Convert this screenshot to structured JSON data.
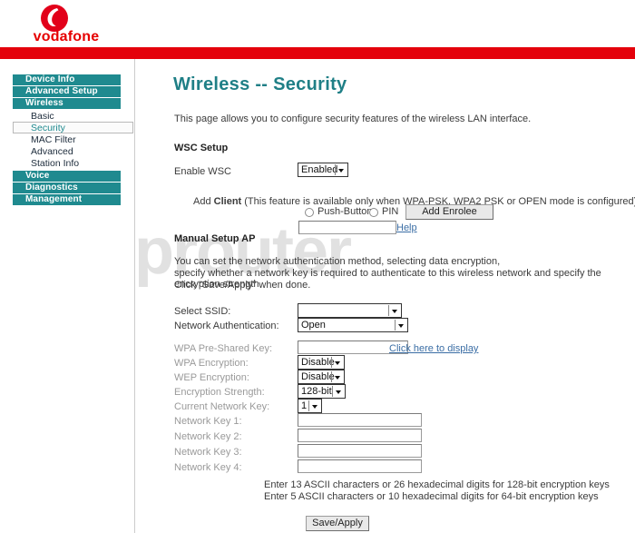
{
  "brand": {
    "name": "vodafone",
    "logo_icon": "vodafone-speechmark-icon",
    "red": "#e4010b",
    "teal": "#1f8a8f"
  },
  "watermark": {
    "text": "setuprouter"
  },
  "sidebar": {
    "groups": [
      {
        "label": "Device Info",
        "type": "head"
      },
      {
        "label": "Advanced Setup",
        "type": "head"
      },
      {
        "label": "Wireless",
        "type": "head"
      },
      {
        "label": "Basic",
        "type": "sub",
        "selected": false
      },
      {
        "label": "Security",
        "type": "sub",
        "selected": true
      },
      {
        "label": "MAC Filter",
        "type": "sub",
        "selected": false
      },
      {
        "label": "Advanced",
        "type": "sub",
        "selected": false
      },
      {
        "label": "Station Info",
        "type": "sub",
        "selected": false
      },
      {
        "label": "Voice",
        "type": "head"
      },
      {
        "label": "Diagnostics",
        "type": "head"
      },
      {
        "label": "Management",
        "type": "head"
      }
    ]
  },
  "main": {
    "title": "Wireless -- Security",
    "description": "This page allows you to configure security features of the wireless LAN interface.",
    "wsc": {
      "heading": "WSC Setup",
      "enable_label": "Enable WSC",
      "enable_value": "Enabled",
      "add_client_prefix": "Add ",
      "add_client_bold": "Client",
      "add_client_suffix": " (This feature is available only when WPA-PSK, WPA2 PSK or OPEN mode is configured)",
      "push_button_label": "Push-Button",
      "pin_label": "PIN",
      "add_enrolee_label": "Add Enrolee",
      "pin_value": "",
      "help_link": "Help"
    },
    "manual": {
      "heading": "Manual Setup AP",
      "desc_line1": "You can set the network authentication method, selecting data encryption,",
      "desc_line2": "specify whether a network key is required to authenticate to this wireless network and specify the encryption strength.",
      "desc_line3": "Click \"Save/Apply\" when done.",
      "fields": {
        "select_ssid_label": "Select SSID:",
        "select_ssid_value": "",
        "network_auth_label": "Network Authentication:",
        "network_auth_value": "Open",
        "wpa_psk_label": "WPA Pre-Shared Key:",
        "wpa_psk_value": "",
        "wpa_psk_link": "Click here to display",
        "wpa_enc_label": "WPA Encryption:",
        "wpa_enc_value": "Disable",
        "wep_enc_label": "WEP Encryption:",
        "wep_enc_value": "Disable",
        "enc_strength_label": "Encryption Strength:",
        "enc_strength_value": "128-bit",
        "current_key_label": "Current Network Key:",
        "current_key_value": "1",
        "key1_label": "Network Key 1:",
        "key1_value": "",
        "key2_label": "Network Key 2:",
        "key2_value": "",
        "key3_label": "Network Key 3:",
        "key3_value": "",
        "key4_label": "Network Key 4:",
        "key4_value": ""
      },
      "note_line1": "Enter 13 ASCII characters or 26 hexadecimal digits for 128-bit encryption keys",
      "note_line2": "Enter 5 ASCII characters or 10 hexadecimal digits for 64-bit encryption keys",
      "save_label": "Save/Apply"
    }
  }
}
